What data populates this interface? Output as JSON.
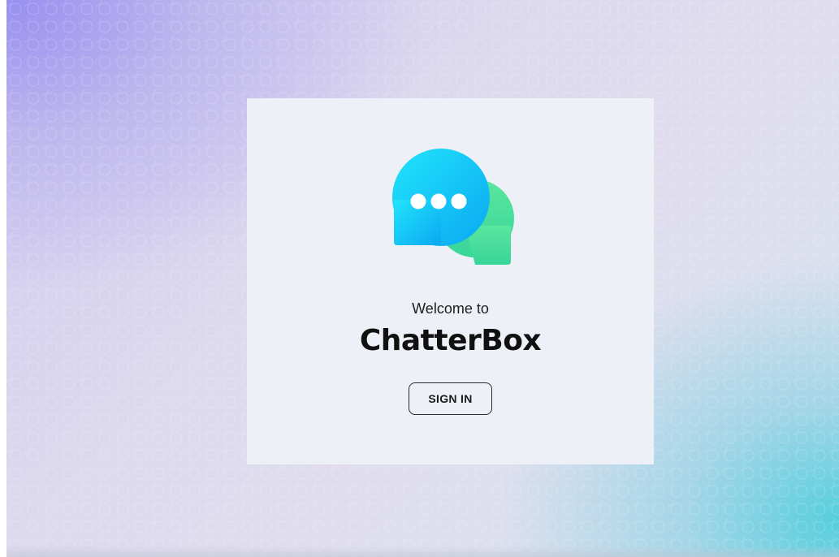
{
  "welcome": {
    "greeting": "Welcome to",
    "app_name": "ChatterBox",
    "signin_label": "SIGN IN"
  },
  "logo": {
    "icon": "chat-bubbles-icon",
    "front_bubble_color": "#10c8f6",
    "back_bubble_color": "#47e09a",
    "dot_color": "#ffffff"
  },
  "colors": {
    "card_background": "#edf0f6",
    "text": "#111111"
  }
}
